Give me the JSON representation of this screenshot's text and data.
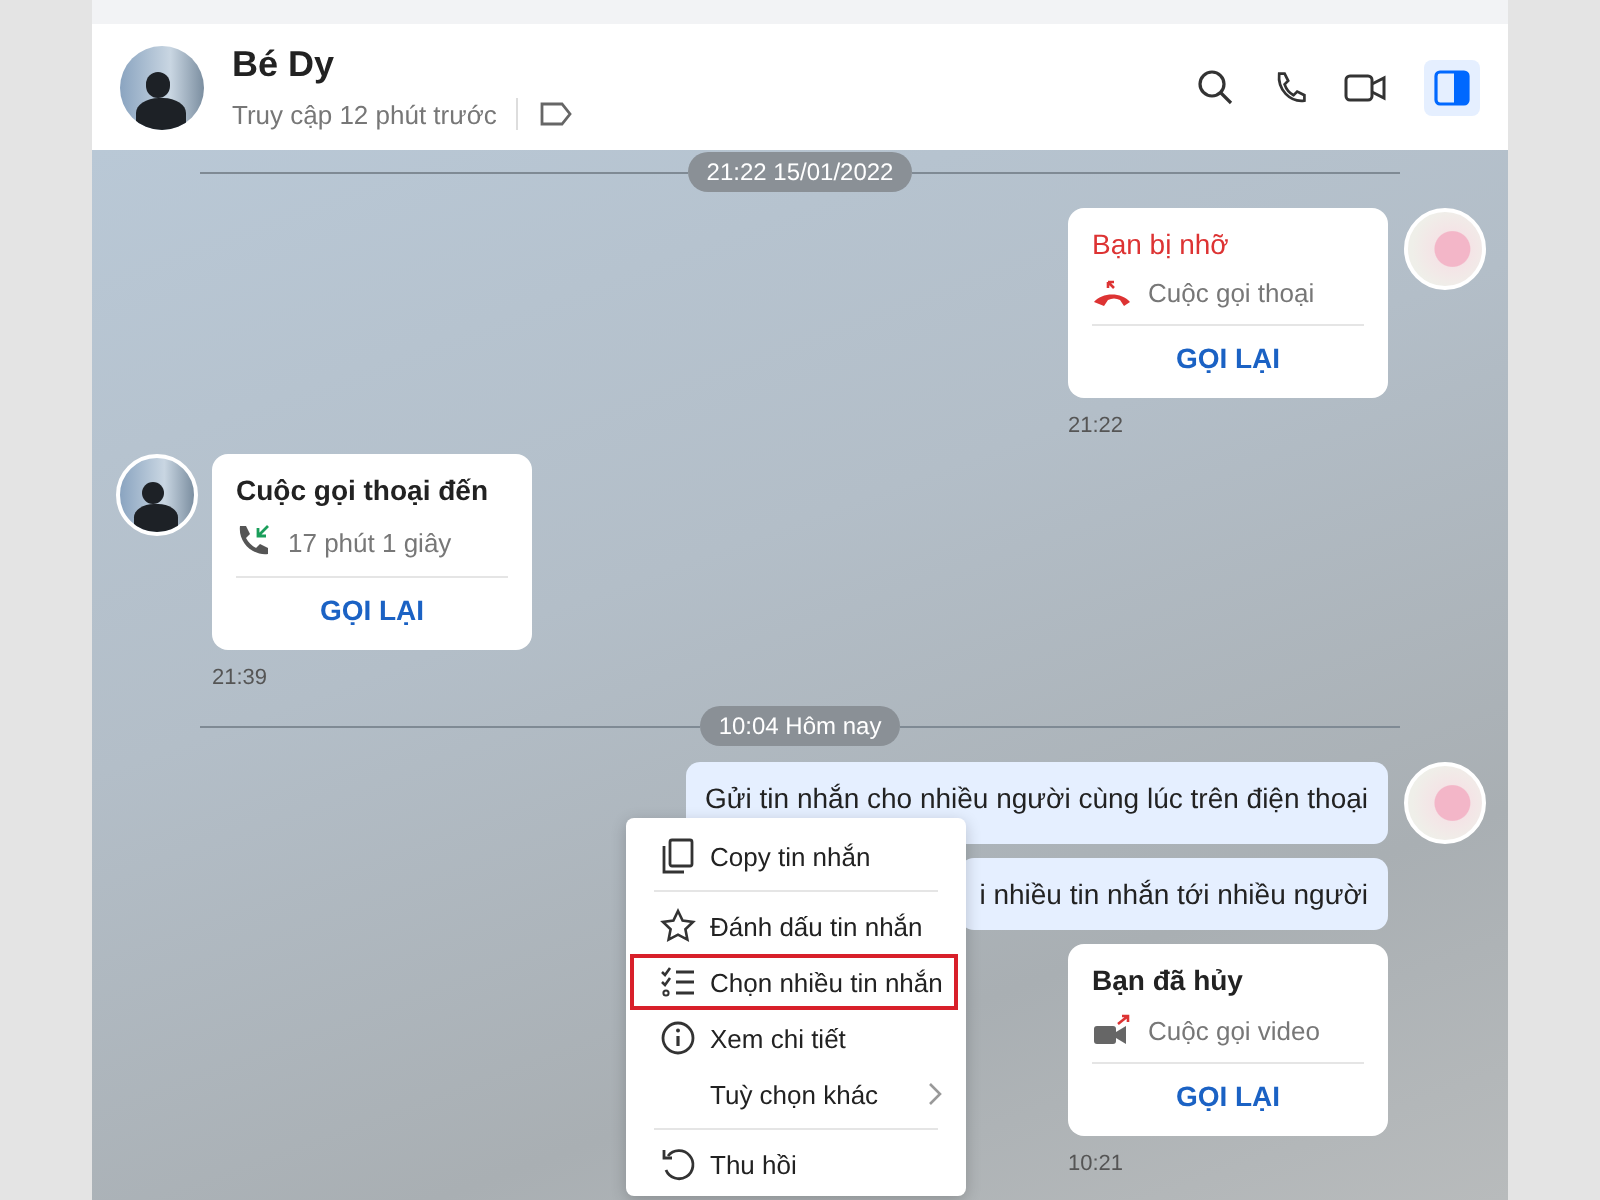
{
  "header": {
    "name": "Bé Dy",
    "status": "Truy cập 12 phút trước",
    "panel_open": true
  },
  "timeline": [
    {
      "kind": "separator",
      "label": "21:22 15/01/2022"
    },
    {
      "kind": "missed_call",
      "avatar": true,
      "title": "Bạn bị nhỡ",
      "detail": "Cuộc gọi thoại",
      "action": "GỌI LẠI",
      "time": "21:22"
    },
    {
      "kind": "incoming_call",
      "avatar": true,
      "title": "Cuộc gọi thoại đến",
      "detail": "17 phút 1 giây",
      "action": "GỌI LẠI",
      "time": "21:39"
    },
    {
      "kind": "separator",
      "label": "10:04 Hôm nay"
    },
    {
      "kind": "message",
      "avatar": true,
      "text": "Gửi tin nhắn cho nhiều người cùng lúc trên điện thoại"
    },
    {
      "kind": "message",
      "avatar": false,
      "text": "i nhiều tin nhắn tới nhiều người"
    },
    {
      "kind": "cancelled_video_call",
      "avatar": false,
      "title": "Bạn đã hủy",
      "detail": "Cuộc gọi video",
      "action": "GỌI LẠI",
      "time": "10:21"
    }
  ],
  "context_menu": [
    {
      "kind": "copy",
      "label": "Copy tin nhắn",
      "selected": false
    },
    {
      "kind": "divider"
    },
    {
      "kind": "star",
      "label": "Đánh dấu tin nhắn",
      "selected": false
    },
    {
      "kind": "multi_select",
      "label": "Chọn nhiều tin nhắn",
      "selected": true
    },
    {
      "kind": "info",
      "label": "Xem chi tiết",
      "selected": false
    },
    {
      "kind": "submenu",
      "label": "Tuỳ chọn khác",
      "selected": false
    },
    {
      "kind": "divider"
    },
    {
      "kind": "recall",
      "label": "Thu hồi",
      "selected": false
    }
  ]
}
